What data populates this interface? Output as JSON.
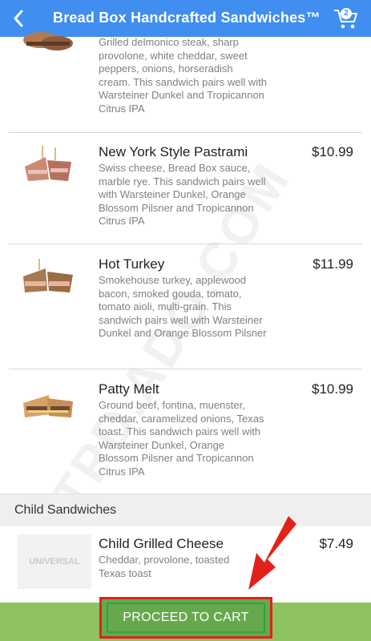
{
  "header": {
    "title": "Bread Box Handcrafted Sandwiches™",
    "cart_count": "2"
  },
  "items": [
    {
      "name": "",
      "price": "",
      "description": "Grilled delmonico steak, sharp provolone, white cheddar, sweet peppers, onions, horseradish cream. This sandwich pairs well with Warsteiner Dunkel and Tropicannon Citrus IPA"
    },
    {
      "name": "New York Style Pastrami",
      "price": "$10.99",
      "description": "Swiss cheese, Bread Box sauce, marble rye. This sandwich pairs well with Warsteiner Dunkel, Orange Blossom Pilsner and Tropicannon Citrus IPA"
    },
    {
      "name": "Hot Turkey",
      "price": "$11.99",
      "description": "Smokehouse turkey, applewood bacon, smoked gouda, tomato, tomato aioli, multi-grain. This sandwich pairs well with Warsteiner Dunkel and Orange Blossom Pilsner"
    },
    {
      "name": "Patty Melt",
      "price": "$10.99",
      "description": "Ground beef, fontina, muenster, cheddar, caramelized onions, Texas toast. This sandwich pairs well with Warsteiner Dunkel, Orange Blossom Pilsner and Tropicannon Citrus IPA"
    }
  ],
  "section": {
    "label": "Child Sandwiches"
  },
  "child_items": [
    {
      "name": "Child Grilled Cheese",
      "price": "$7.49",
      "description": "Cheddar, provolone, toasted Texas toast",
      "logo_text": "UNIVERSAL"
    }
  ],
  "footer": {
    "cta_label": "PROCEED TO CART"
  },
  "watermark": "TPD.ADO.COM",
  "colors": {
    "header": "#3f8ef0",
    "footer": "#8dc25f",
    "annotation": "#e0221b"
  },
  "icons": {
    "back": "chevron-left-icon",
    "cart": "shopping-cart-icon"
  }
}
